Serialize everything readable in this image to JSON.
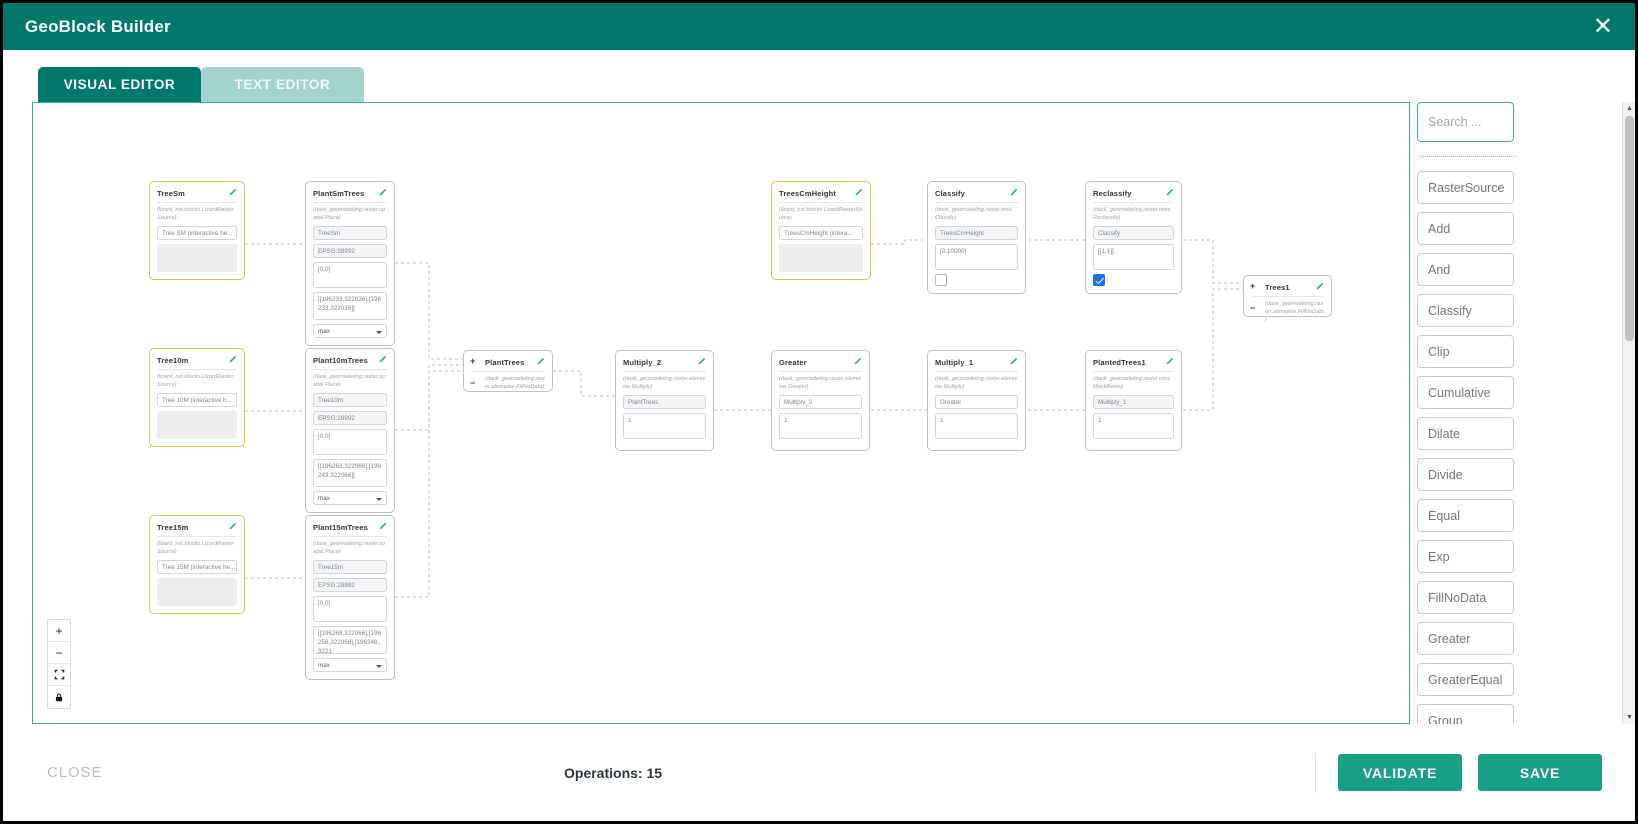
{
  "window": {
    "title": "GeoBlock Builder",
    "close_icon": "close-icon"
  },
  "tabs": [
    {
      "label": "VISUAL EDITOR",
      "active": true
    },
    {
      "label": "TEXT EDITOR",
      "active": false
    }
  ],
  "canvas": {
    "zoom_controls": [
      {
        "name": "zoom-in",
        "glyph": "+"
      },
      {
        "name": "zoom-out",
        "glyph": "−"
      },
      {
        "name": "fit-view",
        "glyph": "⛶"
      },
      {
        "name": "lock",
        "glyph": "🔒"
      }
    ],
    "nodes": [
      {
        "id": "TreeSm",
        "title": "TreeSm",
        "subtitle": "(lizard_nxt.blocks.LizardRasterSource)",
        "selected": true,
        "fields": [
          {
            "type": "text",
            "value": "Tree SM (interactive he..."
          }
        ],
        "blank": true
      },
      {
        "id": "PlantSmTrees",
        "title": "PlantSmTrees",
        "subtitle": "(dask_geomodeling.raster.spatial.Place)",
        "selected": false,
        "fields": [
          {
            "type": "text",
            "value": "TreeSm",
            "filled": true
          },
          {
            "type": "text",
            "value": "EPSG:28992",
            "filled": true
          },
          {
            "type": "area",
            "value": "[0,0]"
          },
          {
            "type": "area2",
            "value": "[[196233,322036],[196233,322036]]"
          },
          {
            "type": "select",
            "value": "max"
          }
        ]
      },
      {
        "id": "Tree10m",
        "title": "Tree10m",
        "subtitle": "(lizard_nxt.blocks.LizardRasterSource)",
        "selected": true,
        "fields": [
          {
            "type": "text",
            "value": "Tree 10M (interactive h..."
          }
        ],
        "blank": true
      },
      {
        "id": "Plant10mTrees",
        "title": "Plant10mTrees",
        "subtitle": "(dask_geomodeling.raster.spatial.Place)",
        "selected": false,
        "fields": [
          {
            "type": "text",
            "value": "Tree10m",
            "filled": true
          },
          {
            "type": "text",
            "value": "EPSG:28992",
            "filled": true
          },
          {
            "type": "area",
            "value": "[0,0]"
          },
          {
            "type": "area2",
            "value": "[[196263,322066],[196243,322066]]"
          },
          {
            "type": "select",
            "value": "max"
          }
        ]
      },
      {
        "id": "Tree15m",
        "title": "Tree15m",
        "subtitle": "(lizard_nxt.blocks.LizardRasterSource)",
        "selected": true,
        "fields": [
          {
            "type": "text",
            "value": "Tree 15M (interactive he..."
          }
        ],
        "blank": true
      },
      {
        "id": "Plant15mTrees",
        "title": "Plant15mTrees",
        "subtitle": "(dask_geomodeling.raster.spatial.Place)",
        "selected": false,
        "fields": [
          {
            "type": "text",
            "value": "Tree15m",
            "filled": true
          },
          {
            "type": "text",
            "value": "EPSG:28992",
            "filled": true
          },
          {
            "type": "area",
            "value": "[0,0]"
          },
          {
            "type": "area2",
            "value": "[[196268,322066],[196258,322066],[196248,3221"
          },
          {
            "type": "select",
            "value": "max"
          }
        ]
      },
      {
        "id": "PlantTrees",
        "title": "PlantTrees",
        "subtitle": "(dask_geomodeling.raster.elemwise.FillNoData)",
        "selected": false,
        "fields": []
      },
      {
        "id": "Multiply_2",
        "title": "Multiply_2",
        "subtitle": "(dask_geomodeling.raster.elemwise.Multiply)",
        "selected": false,
        "fields": [
          {
            "type": "text",
            "value": "PlantTrees",
            "filled": true
          },
          {
            "type": "text",
            "value": "1"
          }
        ]
      },
      {
        "id": "Greater",
        "title": "Greater",
        "subtitle": "(dask_geomodeling.raster.elemwise.Greater)",
        "selected": false,
        "fields": [
          {
            "type": "text",
            "value": "Multiply_2"
          },
          {
            "type": "text",
            "value": "1"
          }
        ]
      },
      {
        "id": "Multiply_1",
        "title": "Multiply_1",
        "subtitle": "(dask_geomodeling.raster.elemwise.Multiply)",
        "selected": false,
        "fields": [
          {
            "type": "text",
            "value": "Greater"
          },
          {
            "type": "text",
            "value": "1"
          }
        ]
      },
      {
        "id": "PlantedTrees1",
        "title": "PlantedTrees1",
        "subtitle": "(dask_geomodeling.raster.misc.MaskBelow)",
        "selected": false,
        "fields": [
          {
            "type": "text",
            "value": "Multiply_1",
            "filled": true
          },
          {
            "type": "text",
            "value": "1"
          }
        ]
      },
      {
        "id": "TreesCmHeight",
        "title": "TreesCmHeight",
        "subtitle": "(lizard_nxt.blocks.LizardRasterSource)",
        "selected": true,
        "fields": [
          {
            "type": "text",
            "value": "TreesCmHeight (intera..."
          }
        ],
        "blank": true
      },
      {
        "id": "Classify",
        "title": "Classify",
        "subtitle": "(dask_geomodeling.raster.misc.Classify)",
        "selected": false,
        "fields": [
          {
            "type": "text",
            "value": "TreesCmHeight",
            "filled": true
          },
          {
            "type": "area",
            "value": "[0,10000]"
          },
          {
            "type": "checkbox",
            "checked": false
          }
        ]
      },
      {
        "id": "Reclassify",
        "title": "Reclassify",
        "subtitle": "(dask_geomodeling.raster.misc.Reclassify)",
        "selected": false,
        "fields": [
          {
            "type": "text",
            "value": "Classify",
            "filled": true
          },
          {
            "type": "area",
            "value": "[[1,1]]"
          },
          {
            "type": "checkbox",
            "checked": true
          }
        ]
      },
      {
        "id": "Trees1",
        "title": "Trees1",
        "subtitle": "(dask_geomodeling.raster.elemwise.FillNoData)",
        "selected": false,
        "fields": []
      }
    ]
  },
  "sidebar": {
    "search": {
      "placeholder": "Search ...",
      "value": ""
    },
    "blocks": [
      "RasterSource",
      "Add",
      "And",
      "Classify",
      "Clip",
      "Cumulative",
      "Dilate",
      "Divide",
      "Equal",
      "Exp",
      "FillNoData",
      "Greater",
      "GreaterEqual",
      "Group"
    ]
  },
  "footer": {
    "close_label": "CLOSE",
    "operations_label": "Operations: 15",
    "validate_label": "VALIDATE",
    "save_label": "SAVE"
  },
  "colors": {
    "brand": "#00796b",
    "accent": "#16a085",
    "selected_node": "#f3b73d",
    "checkbox": "#1a73e8"
  }
}
